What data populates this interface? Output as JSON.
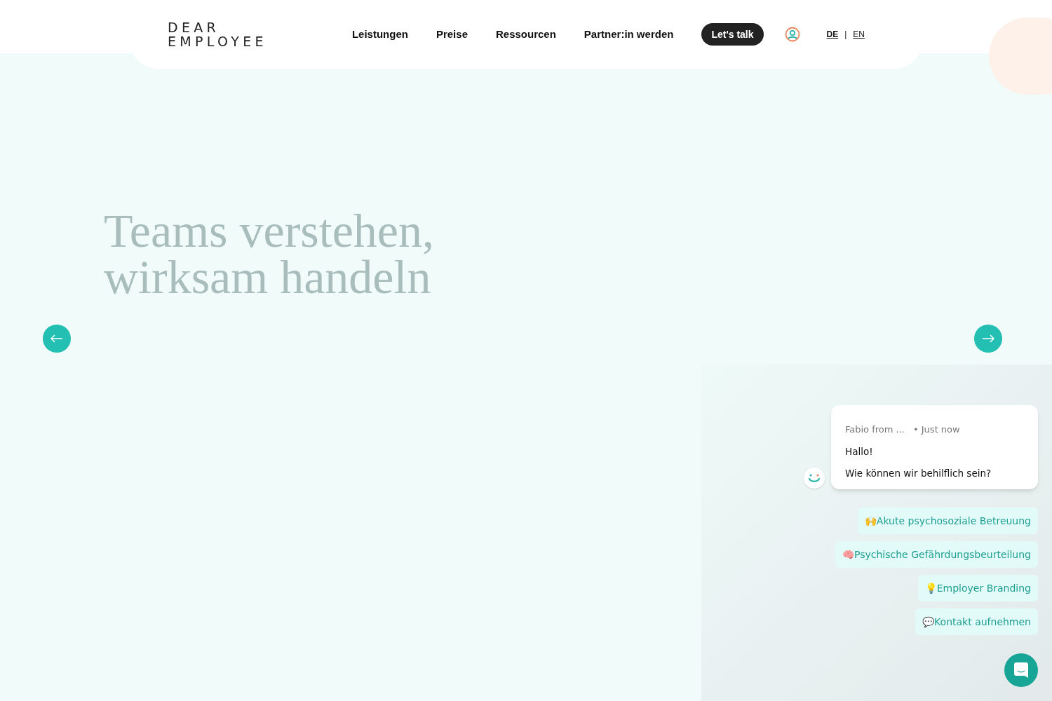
{
  "header": {
    "logo": [
      "DEAR",
      "EMPLOYEE"
    ],
    "nav": [
      {
        "label": "Leistungen"
      },
      {
        "label": "Preise"
      },
      {
        "label": "Ressourcen"
      },
      {
        "label": "Partner:in werden"
      }
    ],
    "cta": "Let's talk",
    "languages": [
      {
        "label": "DE",
        "selected": true
      },
      {
        "label": "EN",
        "selected": false
      }
    ],
    "language_separator": "|"
  },
  "hero": {
    "heading": [
      "Teams verstehen,",
      "wirksam handeln"
    ]
  },
  "chat": {
    "sender": "Fabio from ...",
    "time": "• Just now",
    "lines": [
      "Hallo!",
      "Wie können wir behilflich sein?"
    ],
    "options": [
      "🙌Akute psychosoziale Betreuung",
      "🧠Psychische Gefährdungsbeurteilung",
      "💡Employer Branding",
      "💬Kontakt aufnehmen"
    ]
  }
}
